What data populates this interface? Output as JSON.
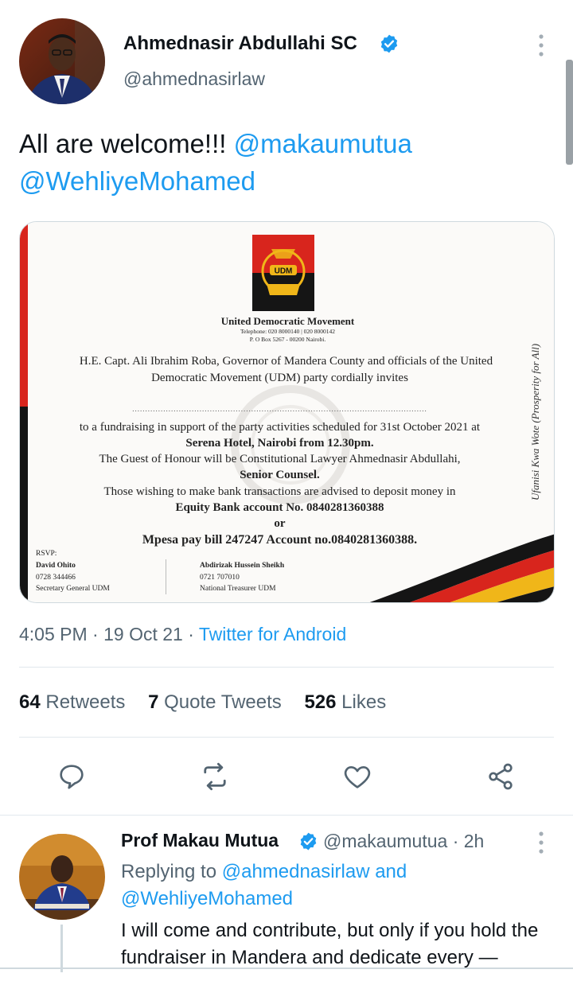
{
  "tweet": {
    "author_name": "Ahmednasir Abdullahi SC",
    "author_handle": "@ahmednasirlaw",
    "text_lead": "All are welcome!!!",
    "mention_1": "@makaumutua",
    "mention_2": "@WehliyeMohamed",
    "time": "4:05 PM",
    "date": "19 Oct 21",
    "separator": "·",
    "source": "Twitter for Android"
  },
  "media_doc": {
    "logo_text": "UDM",
    "org": "United Democratic Movement",
    "contacts": "Telephone: 020 8000140 | 020 8000142",
    "pobox": "P. O Box 5267 - 00200 Nairobi.",
    "line1": "H.E. Capt. Ali Ibrahim Roba, Governor of Mandera County and officials of the United",
    "line2": "Democratic Movement (UDM) party cordially invites",
    "dots": "..................................................................................................................",
    "line3": "to a fundraising in support of the party activities scheduled for 31st October 2021 at",
    "line4": "Serena Hotel, Nairobi from 12.30pm.",
    "line5": "The Guest of Honour will be Constitutional Lawyer Ahmednasir Abdullahi,",
    "line6": "Senior Counsel.",
    "line7": "Those wishing to make bank transactions are advised to deposit money in",
    "line8": "Equity Bank account No. 0840281360388",
    "line9": "or",
    "line10": "Mpesa pay bill 247247 Account no.0840281360388.",
    "rsvp_label": "RSVP:",
    "contact1_name": "David Ohito",
    "contact1_phone": "0728 344466",
    "contact1_role": "Secretary General UDM",
    "contact2_name": "Abdirizak Hussein Sheikh",
    "contact2_phone": "0721 707010",
    "contact2_role": "National Treasurer UDM",
    "slogan": "Ufanisi Kwa Wote (Prosperity for All)"
  },
  "stats": {
    "retweets_count": "64",
    "retweets_label": "Retweets",
    "quotes_count": "7",
    "quotes_label": "Quote Tweets",
    "likes_count": "526",
    "likes_label": "Likes"
  },
  "reply": {
    "author_name": "Prof Makau Mutua",
    "author_handle": "@makaumutua",
    "separator": "·",
    "age": "2h",
    "replying_prefix": "Replying to",
    "replying_handle_1": "@ahmednasirlaw",
    "replying_and": "and",
    "replying_handle_2": "@WehliyeMohamed",
    "text": "I will come and contribute, but only if you hold the fundraiser in Mandera and dedicate every —"
  },
  "icons": [
    "verified-badge-icon",
    "more-vertical-icon",
    "reply-icon",
    "retweet-icon",
    "like-icon",
    "share-icon"
  ],
  "colors": {
    "accent": "#1d9bf0",
    "text_primary": "#0f1419",
    "text_secondary": "#536471",
    "divider": "#e1e8ed"
  }
}
